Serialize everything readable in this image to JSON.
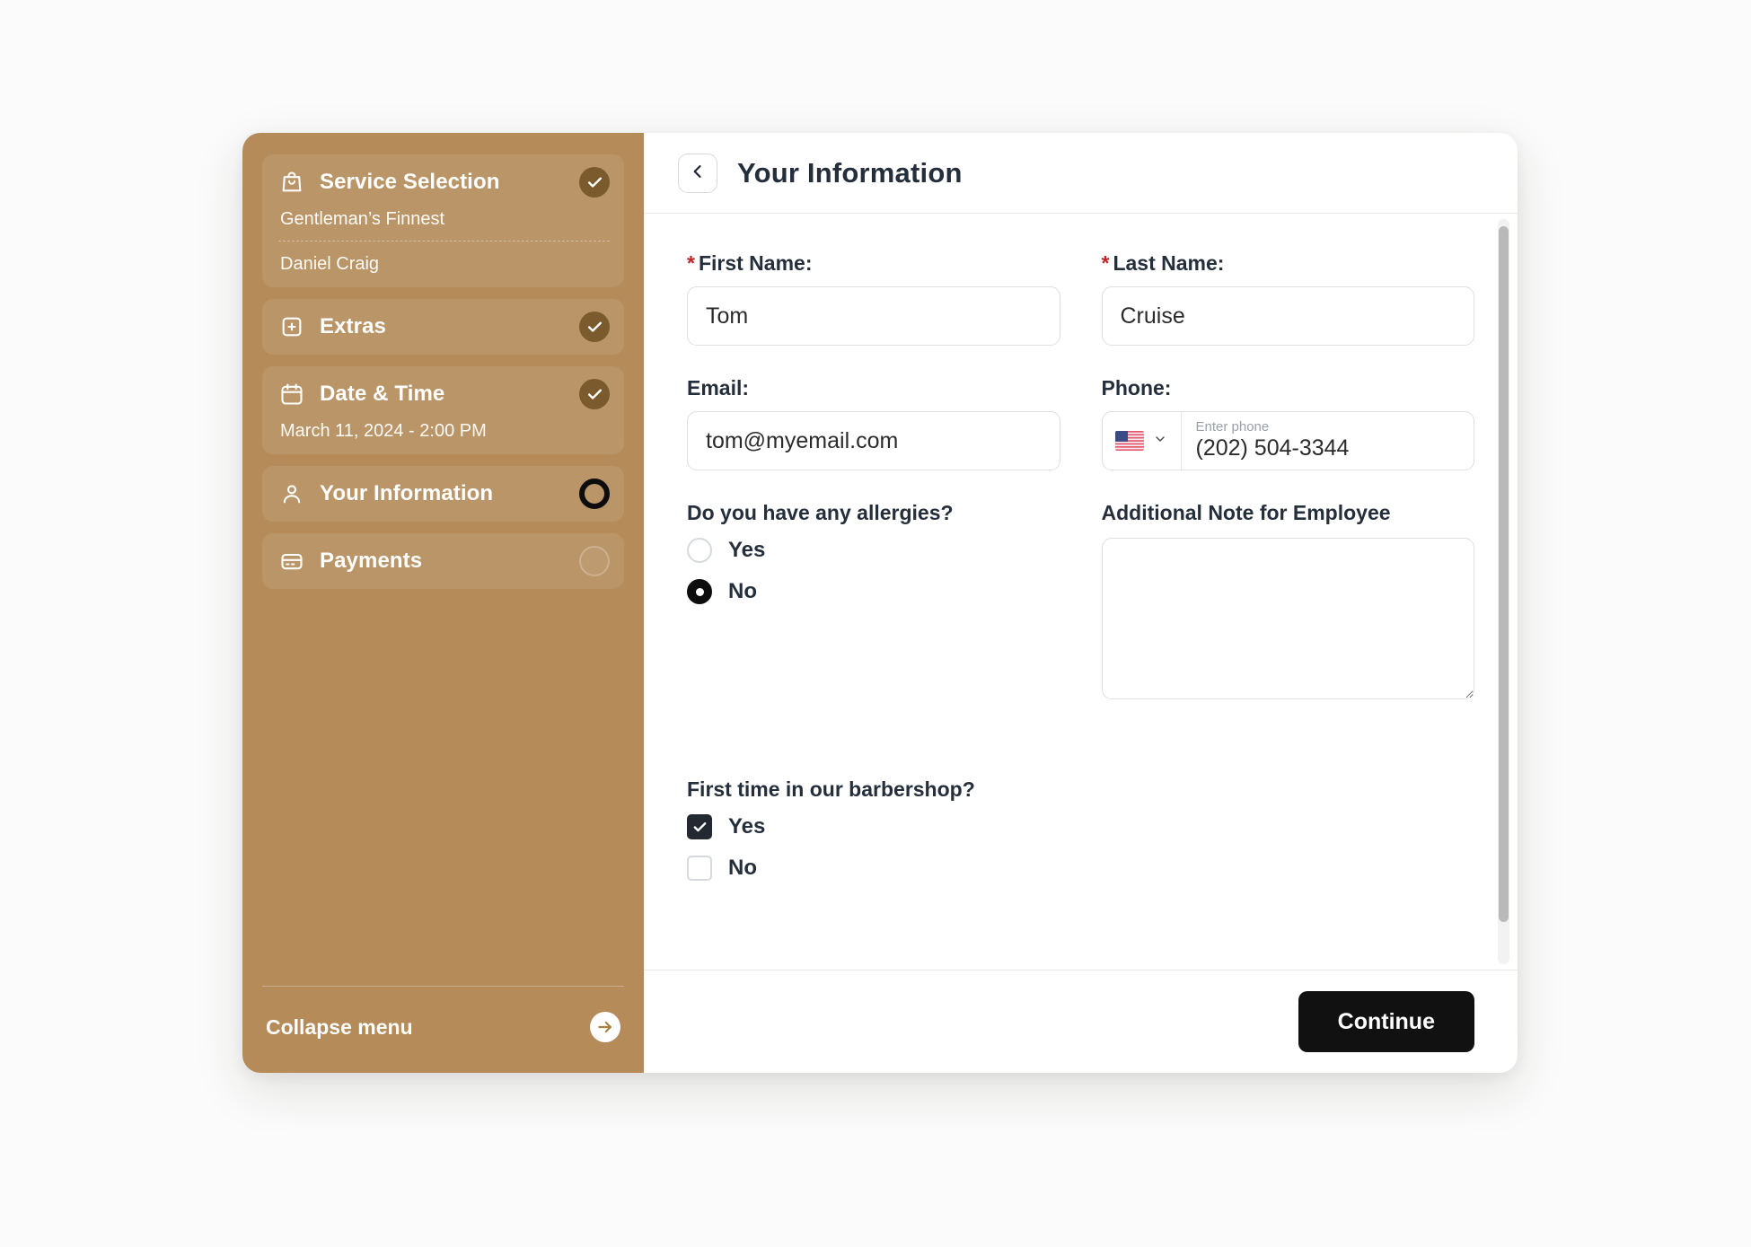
{
  "sidebar": {
    "steps": [
      {
        "id": "service-selection",
        "label": "Service Selection",
        "icon": "shopping-bag-icon",
        "status": "done",
        "sub1": "Gentleman’s Finnest",
        "sub2": "Daniel Craig"
      },
      {
        "id": "extras",
        "label": "Extras",
        "icon": "plus-square-icon",
        "status": "done"
      },
      {
        "id": "date-time",
        "label": "Date & Time",
        "icon": "calendar-icon",
        "status": "done",
        "sub1": "March 11, 2024 - 2:00 PM"
      },
      {
        "id": "your-information",
        "label": "Your Information",
        "icon": "user-icon",
        "status": "active"
      },
      {
        "id": "payments",
        "label": "Payments",
        "icon": "credit-card-icon",
        "status": "todo"
      }
    ],
    "collapse_label": "Collapse menu",
    "collapse_icon": "arrow-right-circle-icon",
    "background_color": "#b48b59",
    "badge_done_color": "#7b5b2d",
    "badge_active_color": "#0d0d0d"
  },
  "header": {
    "back_icon": "chevron-left-icon",
    "title": "Your Information"
  },
  "form": {
    "first_name": {
      "label": "First Name:",
      "required_marker": "*",
      "value": "Tom",
      "placeholder": ""
    },
    "last_name": {
      "label": "Last Name:",
      "required_marker": "*",
      "value": "Cruise",
      "placeholder": ""
    },
    "email": {
      "label": "Email:",
      "value": "tom@myemail.com",
      "placeholder": ""
    },
    "phone": {
      "label": "Phone:",
      "country_flag": "us-flag-icon",
      "dropdown_icon": "chevron-down-icon",
      "floating_label": "Enter phone",
      "value": "(202) 504-3344"
    },
    "allergies": {
      "question": "Do you have any allergies?",
      "options": [
        {
          "label": "Yes",
          "selected": false
        },
        {
          "label": "No",
          "selected": true
        }
      ]
    },
    "additional_note": {
      "label": "Additional Note for Employee",
      "value": "",
      "placeholder": ""
    },
    "first_time": {
      "question": "First time in our barbershop?",
      "options": [
        {
          "label": "Yes",
          "checked": true
        },
        {
          "label": "No",
          "checked": false
        }
      ]
    }
  },
  "footer": {
    "continue_label": "Continue"
  },
  "colors": {
    "accent": "#b48b59",
    "required": "#c02626",
    "text": "#252f3b",
    "button": "#111111"
  }
}
